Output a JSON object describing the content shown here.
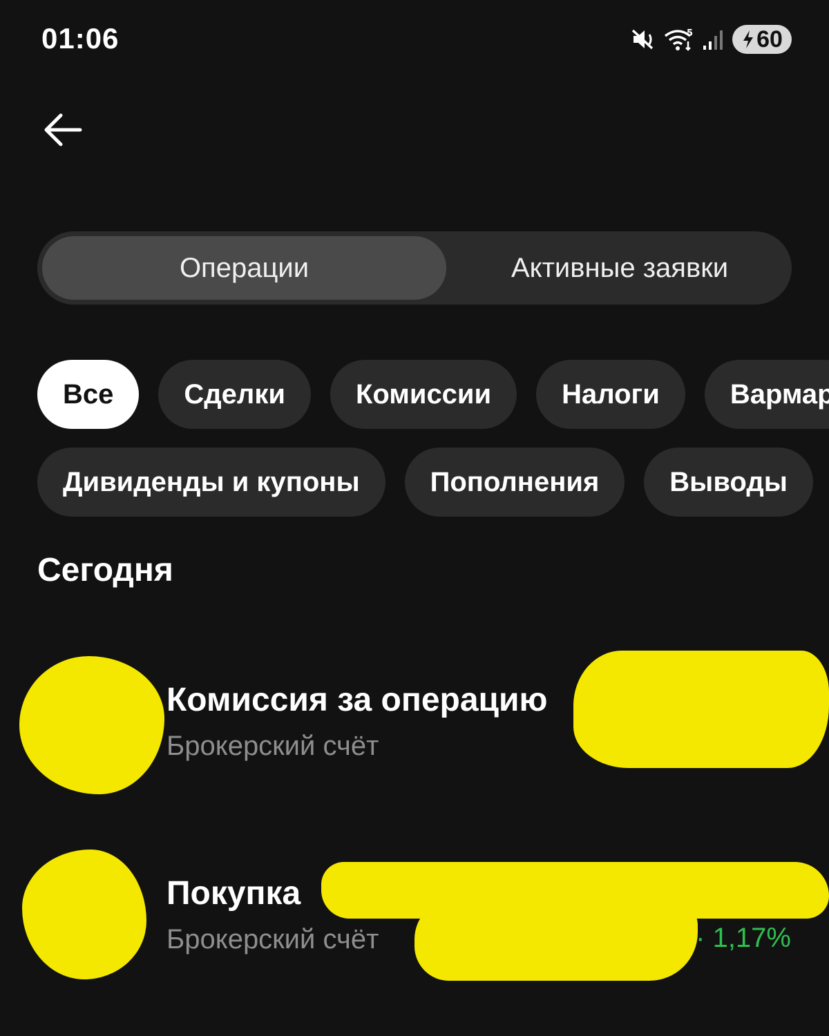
{
  "status_bar": {
    "time": "01:06",
    "icons": [
      "mute-icon",
      "wifi-icon",
      "signal-icon"
    ],
    "battery_level": "60",
    "battery_charging": true
  },
  "header": {
    "back_icon": "arrow-left-icon"
  },
  "segmented": {
    "tabs": [
      {
        "label": "Операции",
        "active": true
      },
      {
        "label": "Активные заявки",
        "active": false
      }
    ]
  },
  "filters": {
    "row1": [
      "Все",
      "Сделки",
      "Комиссии",
      "Налоги",
      "Вармар"
    ],
    "row2": [
      "Дивиденды и купоны",
      "Пополнения",
      "Выводы"
    ],
    "selected": "Все"
  },
  "section": {
    "title": "Сегодня"
  },
  "operations": [
    {
      "title": "Комиссия за операцию",
      "subtitle": "Брокерский счёт",
      "change": ""
    },
    {
      "title": "Покупка",
      "subtitle": "Брокерский счёт",
      "change": "· 1,17%"
    }
  ],
  "colors": {
    "background": "#121212",
    "chip": "#2b2b2b",
    "chip_selected": "#ffffff",
    "redaction": "#f5e800",
    "positive": "#2fbf4f"
  }
}
